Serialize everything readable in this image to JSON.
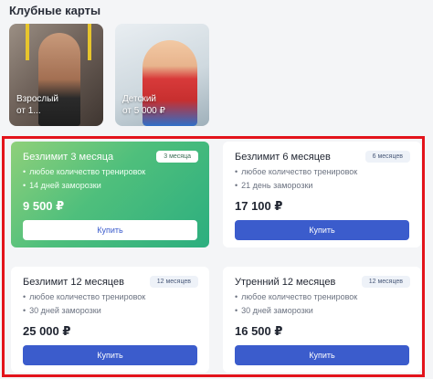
{
  "section": {
    "title": "Клубные карты"
  },
  "promos": [
    {
      "name": "Взрослый",
      "price": "от 1..."
    },
    {
      "name": "Детский",
      "price": "от 5 000 ₽"
    }
  ],
  "cards": [
    {
      "title": "Безлимит 3 месяца",
      "badge": "3 месяца",
      "features": [
        "любое количество тренировок",
        "14 дней заморозки"
      ],
      "price": "9 500 ₽",
      "button": "Купить"
    },
    {
      "title": "Безлимит 6 месяцев",
      "badge": "6 месяцев",
      "features": [
        "любое количество тренировок",
        "21 день заморозки"
      ],
      "price": "17 100 ₽",
      "button": "Купить"
    },
    {
      "title": "Безлимит 12 месяцев",
      "badge": "12 месяцев",
      "features": [
        "любое количество тренировок",
        "30 дней заморозки"
      ],
      "price": "25 000 ₽",
      "button": "Купить"
    },
    {
      "title": "Утренний 12 месяцев",
      "badge": "12 месяцев",
      "features": [
        "любое количество тренировок",
        "30 дней заморозки"
      ],
      "price": "16 500 ₽",
      "button": "Купить"
    }
  ],
  "colors": {
    "accent": "#3b5ccc",
    "highlight_frame": "#e3131b",
    "featured_card": "#4fbf7c"
  },
  "feature_bullet": "•"
}
